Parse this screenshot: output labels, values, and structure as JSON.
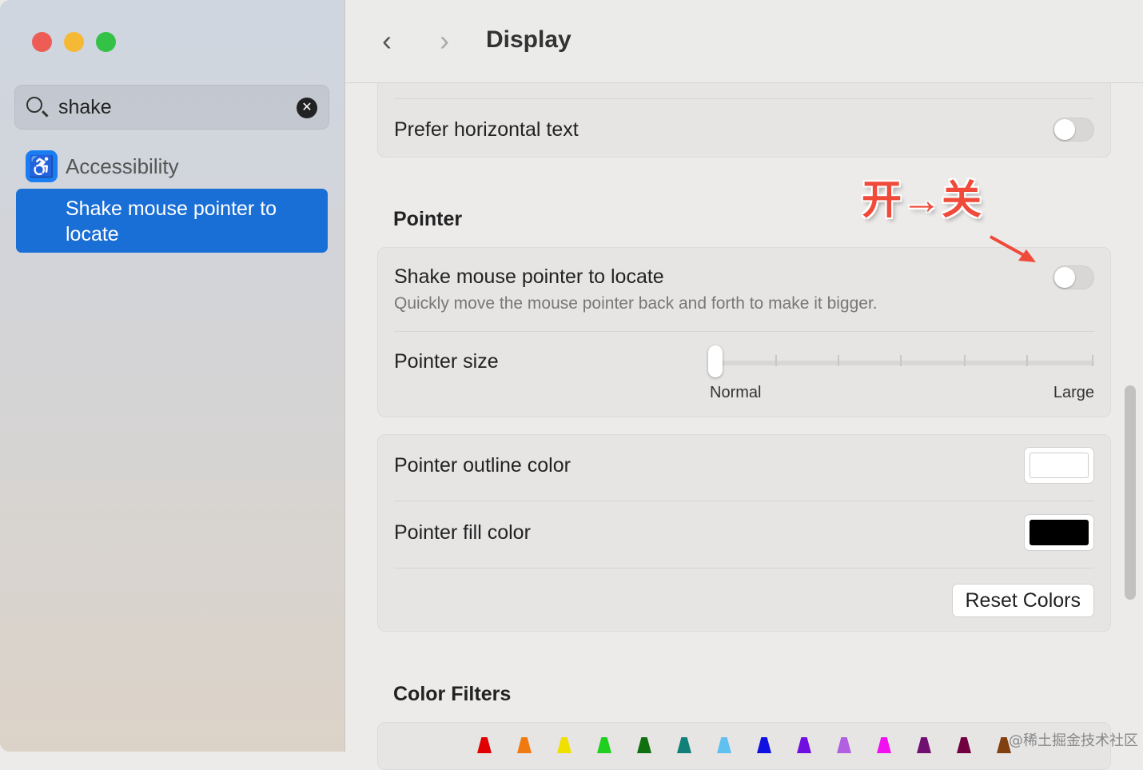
{
  "window": {
    "traffic_colors": [
      "#ee5d55",
      "#f5b935",
      "#33c146"
    ]
  },
  "sidebar": {
    "search_value": "shake",
    "category": "Accessibility",
    "result": "Shake mouse pointer to locate"
  },
  "header": {
    "title": "Display",
    "back": "‹",
    "forward": "›"
  },
  "main": {
    "prefer_horizontal": {
      "label": "Prefer horizontal text",
      "on": false
    },
    "pointer_heading": "Pointer",
    "shake": {
      "label": "Shake mouse pointer to locate",
      "description": "Quickly move the mouse pointer back and forth to make it bigger.",
      "on": false
    },
    "pointer_size": {
      "label": "Pointer size",
      "min_label": "Normal",
      "max_label": "Large",
      "value_fraction": 0
    },
    "outline_color": {
      "label": "Pointer outline color",
      "color": "#ffffff"
    },
    "fill_color": {
      "label": "Pointer fill color",
      "color": "#000000"
    },
    "reset_label": "Reset Colors",
    "color_filters_heading": "Color Filters",
    "crayons": [
      "#e00000",
      "#f07a10",
      "#f0e000",
      "#20d020",
      "#107010",
      "#108078",
      "#60c0f0",
      "#1010e0",
      "#7010e0",
      "#b060e0",
      "#f010f0",
      "#701070",
      "#700040",
      "#804010"
    ]
  },
  "annotation": {
    "text": "开→关"
  },
  "watermark": "@稀土掘金技术社区"
}
